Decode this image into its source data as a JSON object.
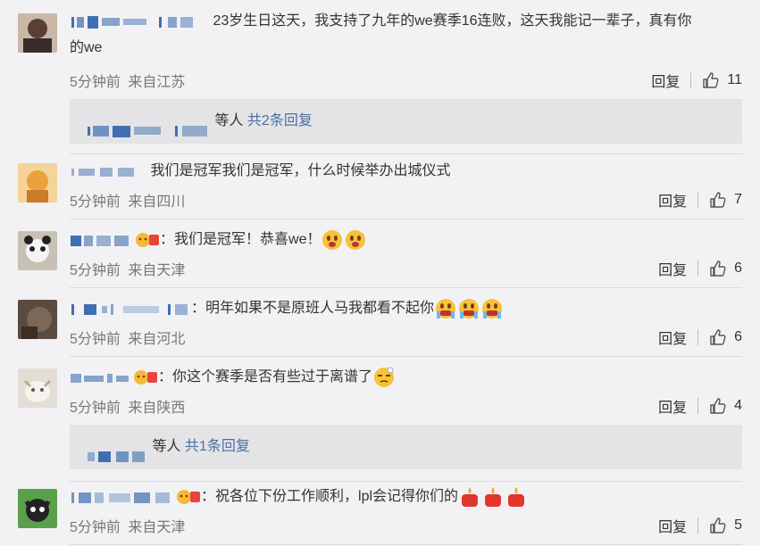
{
  "comments": [
    {
      "text_a": "23岁生日这天，我支持了九年的we赛季16连败，这天我能记一辈子，真有你",
      "text_b": "的we",
      "time": "5分钟前",
      "location": "来自江苏",
      "reply_label": "回复",
      "likes": "11",
      "sub": {
        "suffix": "等人",
        "link": "共2条回复"
      }
    },
    {
      "text": "我们是冠军我们是冠军，什么时候举办出城仪式",
      "time": "5分钟前",
      "location": "来自四川",
      "reply_label": "回复",
      "likes": "7"
    },
    {
      "text": "我们是冠军！恭喜we！",
      "time": "5分钟前",
      "location": "来自天津",
      "reply_label": "回复",
      "likes": "6"
    },
    {
      "text": "明年如果不是原班人马我都看不起你",
      "time": "5分钟前",
      "location": "来自河北",
      "reply_label": "回复",
      "likes": "6"
    },
    {
      "text": "你这个赛季是否有些过于离谱了",
      "time": "5分钟前",
      "location": "来自陕西",
      "reply_label": "回复",
      "likes": "4",
      "sub": {
        "suffix": "等人",
        "link": "共1条回复"
      }
    },
    {
      "text": "祝各位下份工作顺利，lpl会记得你们的",
      "time": "5分钟前",
      "location": "来自天津",
      "reply_label": "回复",
      "likes": "5"
    }
  ],
  "colon": "：",
  "colors": {
    "link": "#4a6fa5",
    "meta": "#777777",
    "background": "#f2f2f4"
  },
  "icons": [
    "thumbs-up-icon",
    "vip-badge-icon",
    "emoji-icon"
  ]
}
